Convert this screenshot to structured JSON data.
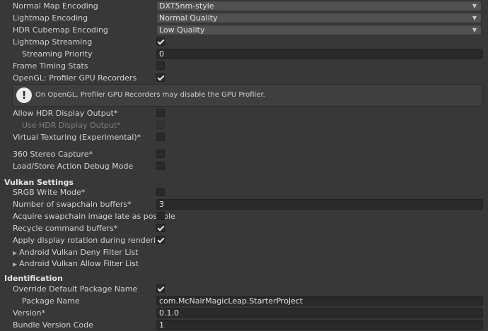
{
  "settings": {
    "normal_map_encoding": {
      "label": "Normal Map Encoding",
      "value": "DXT5nm-style"
    },
    "lightmap_encoding": {
      "label": "Lightmap Encoding",
      "value": "Normal Quality"
    },
    "hdr_cubemap_encoding": {
      "label": "HDR Cubemap Encoding",
      "value": "Low Quality"
    },
    "lightmap_streaming": {
      "label": "Lightmap Streaming",
      "checked": true
    },
    "streaming_priority": {
      "label": "Streaming Priority",
      "value": "0"
    },
    "frame_timing_stats": {
      "label": "Frame Timing Stats",
      "checked": false
    },
    "opengl_profiler": {
      "label": "OpenGL: Profiler GPU Recorders",
      "checked": true
    },
    "help_message": "On OpenGL, Profiler GPU Recorders may disable the GPU Profiler.",
    "allow_hdr_display": {
      "label": "Allow HDR Display Output*",
      "checked": false
    },
    "use_hdr_display": {
      "label": "Use HDR Display Output*",
      "checked": false,
      "disabled": true
    },
    "virtual_texturing": {
      "label": "Virtual Texturing (Experimental)*",
      "checked": false
    },
    "stereo_capture": {
      "label": "360 Stereo Capture*",
      "checked": false
    },
    "load_store_debug": {
      "label": "Load/Store Action Debug Mode",
      "checked": false
    }
  },
  "vulkan": {
    "title": "Vulkan Settings",
    "srgb_write": {
      "label": "SRGB Write Mode*",
      "checked": false
    },
    "swapchain_buffers": {
      "label": "Number of swapchain buffers*",
      "value": "3"
    },
    "acquire_late": {
      "label": "Acquire swapchain image late as possible",
      "checked": false
    },
    "recycle_buffers": {
      "label": "Recycle command buffers*",
      "checked": true
    },
    "display_rotation": {
      "label": "Apply display rotation during rendering",
      "checked": true
    },
    "deny_filter": "Android Vulkan Deny Filter List",
    "allow_filter": "Android Vulkan Allow Filter List"
  },
  "identification": {
    "title": "Identification",
    "override_package": {
      "label": "Override Default Package Name",
      "checked": true
    },
    "package_name": {
      "label": "Package Name",
      "value": "com.McNairMagicLeap.StarterProject"
    },
    "version": {
      "label": "Version*",
      "value": "0.1.0"
    },
    "bundle_code": {
      "label": "Bundle Version Code",
      "value": "1"
    }
  },
  "icons": {
    "dropdown_arrow": "chevron-down-icon",
    "info": "info-icon",
    "foldout": "triangle-right-icon"
  }
}
